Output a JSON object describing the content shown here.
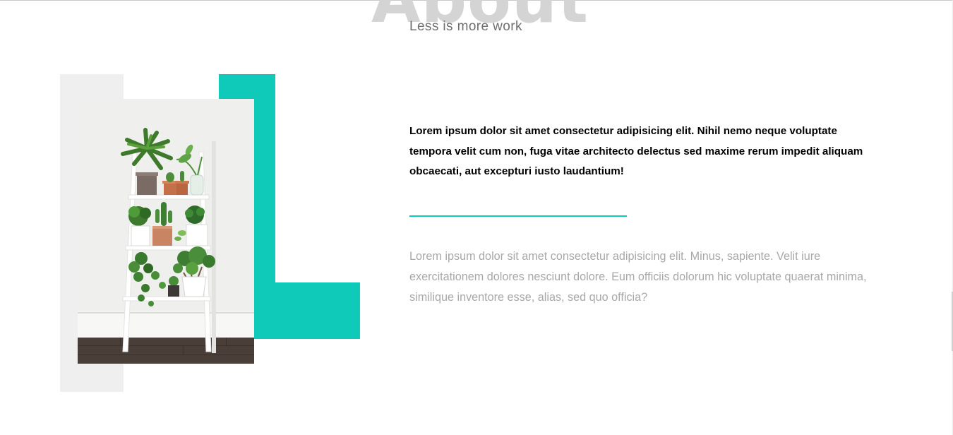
{
  "about": {
    "heading": "About",
    "subtitle": "Less is more work",
    "lead": "Lorem ipsum dolor sit amet consectetur adipisicing elit. Nihil nemo neque voluptate tempora velit cum non, fuga vitae architecto delectus sed maxime rerum impedit aliquam obcaecati, aut excepturi iusto laudantium!",
    "body": "Lorem ipsum dolor sit amet consectetur adipisicing elit. Minus, sapiente. Velit iure exercitationem dolores nesciunt dolore. Eum officiis dolorum hic voluptate quaerat minima, similique inventore esse, alias, sed quo officia?"
  },
  "colors": {
    "accent": "#0fc9b9",
    "heading_grey": "#d4d4d4",
    "block_grey": "#efefef",
    "lead_text": "#000000",
    "body_text": "#a8a8a8"
  },
  "image": {
    "subject": "houseplants on a white ladder shelf"
  }
}
